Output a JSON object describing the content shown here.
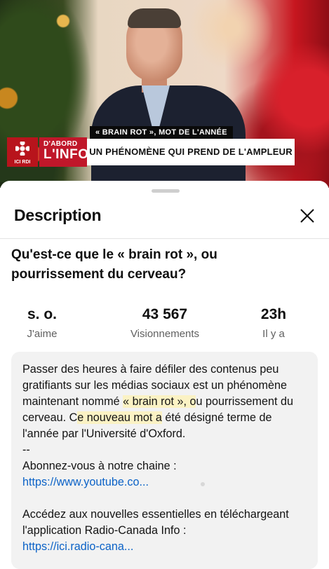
{
  "video": {
    "lower_third_top": "« BRAIN ROT », MOT DE L'ANNÉE",
    "lower_third_main": "UN PHÉNOMÈNE QUI PREND DE L'AMPLEUR",
    "network_logo": "ICI RDI",
    "brand_line1": "D'ABORD",
    "brand_line2": "L'INFO"
  },
  "sheet": {
    "title": "Description",
    "video_title": "Qu'est-ce que le « brain rot », ou pourrissement du cerveau?",
    "stats": {
      "likes_value": "s. o.",
      "likes_label": "J'aime",
      "views_value": "43 567",
      "views_label": "Visionnements",
      "ago_value": "23h",
      "ago_label": "Il y a"
    },
    "description": {
      "p1_a": "Passer des heures à faire défiler des contenus peu gratifiants sur les médias sociaux est un phénomène maintenant nommé ",
      "p1_hl1": "« brain rot », o",
      "p1_b": "u pourrissement du cerveau. C",
      "p1_hl2": "e nouveau mot a",
      "p1_c": " été désigné terme de l'année par l'Université d'Oxford.",
      "separator": "--",
      "subscribe_text": "Abonnez-vous à notre chaine :",
      "subscribe_link": "https://www.youtube.co...",
      "app_text": "Accédez aux nouvelles essentielles en téléchargeant l'application Radio-Canada Info :",
      "app_link": "https://ici.radio-cana..."
    }
  },
  "colors": {
    "link": "#0b62c7",
    "highlight": "#fbf2c4",
    "brand_red": "#c0172a"
  }
}
